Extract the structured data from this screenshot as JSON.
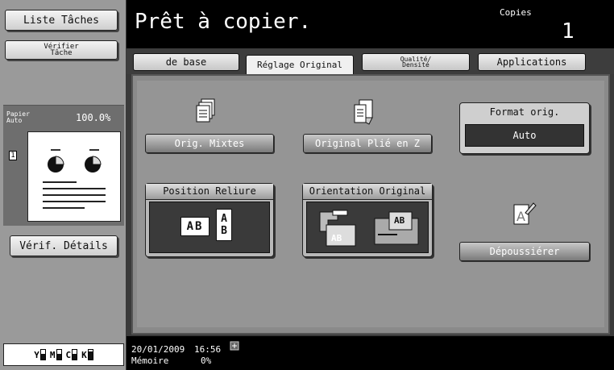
{
  "sidebar": {
    "job_list_button": "Liste Tâches",
    "verify_job_button_line1": "Vérifier",
    "verify_job_button_line2": "Tâche",
    "paper_label_line1": "Papier",
    "paper_label_line2": "Auto",
    "zoom": "100.0%",
    "copies_indicator": "1",
    "verify_details_button": "Vérif. Détails",
    "toner": [
      {
        "color": "Y",
        "level": 0.55
      },
      {
        "color": "M",
        "level": 0.55
      },
      {
        "color": "C",
        "level": 0.55
      },
      {
        "color": "K",
        "level": 0.85
      }
    ]
  },
  "header": {
    "title": "Prêt à copier.",
    "copies_label": "Copies",
    "copies_value": "1"
  },
  "tabs": {
    "basic": "de base",
    "original_settings": "Réglage Original",
    "quality_line1": "Qualité/",
    "quality_line2": "Densité",
    "applications": "Applications"
  },
  "main": {
    "mixed_originals": "Orig. Mixtes",
    "z_folded": "Original Plié en Z",
    "original_size_title": "Format orig.",
    "original_size_value": "Auto",
    "binding_position_title": "Position Reliure",
    "binding_ab": "AB",
    "binding_a": "A",
    "binding_b": "B",
    "orientation_title": "Orientation Original",
    "orientation_text_1": "AB",
    "orientation_text_2": "AB",
    "despeckle": "Dépoussiérer"
  },
  "footer": {
    "date": "20/01/2009",
    "time": "16:56",
    "memory_label": "Mémoire",
    "memory_value": "0%"
  },
  "colors": {
    "header_bg": "#000000",
    "panel_dark": "#3a3a3a",
    "button_gray": "#7a7a7a"
  }
}
